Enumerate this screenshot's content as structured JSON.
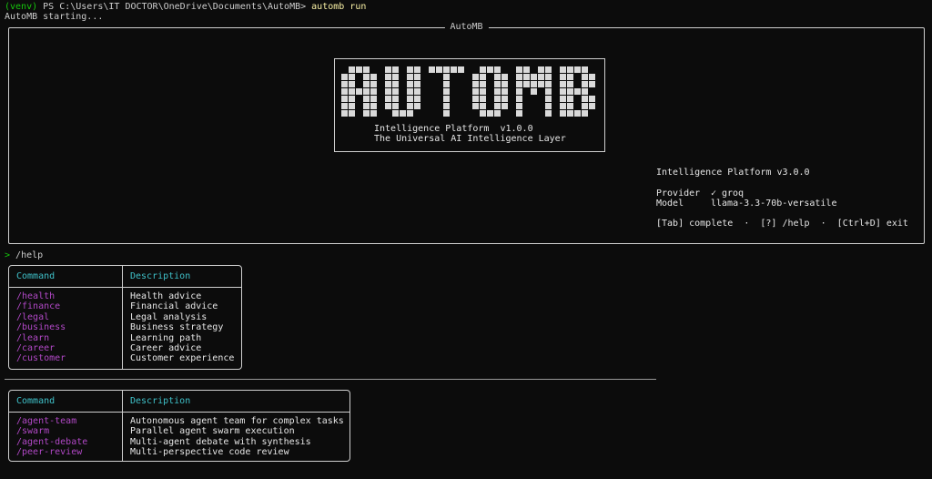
{
  "prompt": {
    "venv": "(venv)",
    "path": " PS C:\\Users\\IT DOCTOR\\OneDrive\\Documents\\AutoMB> ",
    "command": "automb run"
  },
  "status_line": "AutoMB starting...",
  "panel": {
    "title": "AutoMB",
    "logo_text": "AUTOMB",
    "logo_subtitle": "Intelligence Platform  v1.0.0",
    "logo_tagline": "The Universal AI Intelligence Layer",
    "platform_line": "Intelligence Platform v3.0.0",
    "provider_label": "Provider",
    "provider_check": "✓",
    "provider_value": "groq",
    "model_label": "Model",
    "model_value": "llama-3.3-70b-versatile",
    "shortcuts": "[Tab] complete  ·  [?] /help  ·  [Ctrl+D] exit"
  },
  "input": {
    "marker": ">",
    "text": " /help"
  },
  "table1": {
    "headers": [
      "Command",
      "Description"
    ],
    "rows": [
      {
        "cmd": "/health",
        "desc": "Health advice"
      },
      {
        "cmd": "/finance",
        "desc": "Financial advice"
      },
      {
        "cmd": "/legal",
        "desc": "Legal analysis"
      },
      {
        "cmd": "/business",
        "desc": "Business strategy"
      },
      {
        "cmd": "/learn",
        "desc": "Learning path"
      },
      {
        "cmd": "/career",
        "desc": "Career advice"
      },
      {
        "cmd": "/customer",
        "desc": "Customer experience"
      }
    ]
  },
  "table2": {
    "headers": [
      "Command",
      "Description"
    ],
    "rows": [
      {
        "cmd": "/agent-team",
        "desc": "Autonomous agent team for complex tasks"
      },
      {
        "cmd": "/swarm",
        "desc": "Parallel agent swarm execution"
      },
      {
        "cmd": "/agent-debate",
        "desc": "Multi-agent debate with synthesis"
      },
      {
        "cmd": "/peer-review",
        "desc": "Multi-perspective code review"
      }
    ]
  },
  "colors": {
    "background": "#0c0c0c",
    "prompt_green": "#16c60c",
    "command_yellow": "#f9f1a5",
    "slash_magenta": "#b148c6",
    "header_cyan": "#3fc1c9",
    "text": "#cccccc"
  }
}
